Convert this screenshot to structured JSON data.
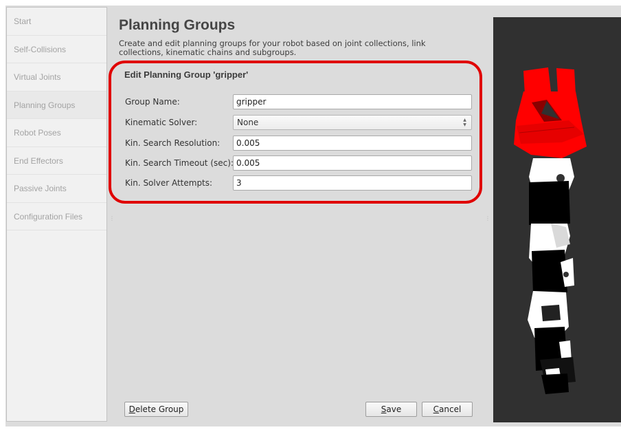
{
  "sidebar": {
    "items": [
      {
        "label": "Start"
      },
      {
        "label": "Self-Collisions"
      },
      {
        "label": "Virtual Joints"
      },
      {
        "label": "Planning Groups"
      },
      {
        "label": "Robot Poses"
      },
      {
        "label": "End Effectors"
      },
      {
        "label": "Passive Joints"
      },
      {
        "label": "Configuration Files"
      }
    ]
  },
  "main": {
    "title": "Planning Groups",
    "description": "Create and edit planning groups for your robot based on joint collections, link collections, kinematic chains and subgroups.",
    "group_title": "Edit Planning Group 'gripper'",
    "fields": {
      "group_name": {
        "label": "Group Name:",
        "value": "gripper"
      },
      "kinematic_solver": {
        "label": "Kinematic Solver:",
        "value": "None"
      },
      "search_resolution": {
        "label": "Kin. Search Resolution:",
        "value": "0.005"
      },
      "search_timeout": {
        "label": "Kin. Search Timeout (sec):",
        "value": "0.005"
      },
      "solver_attempts": {
        "label": "Kin. Solver Attempts:",
        "value": "3"
      }
    },
    "buttons": {
      "delete_group": {
        "mnemonic": "D",
        "rest": "elete Group"
      },
      "save": {
        "mnemonic": "S",
        "rest": "ave"
      },
      "cancel": {
        "mnemonic": "C",
        "rest": "ancel"
      }
    }
  },
  "colors": {
    "highlight": "#e00000",
    "robot_link_highlight": "#ff0000",
    "viewer_bg": "#303030"
  }
}
